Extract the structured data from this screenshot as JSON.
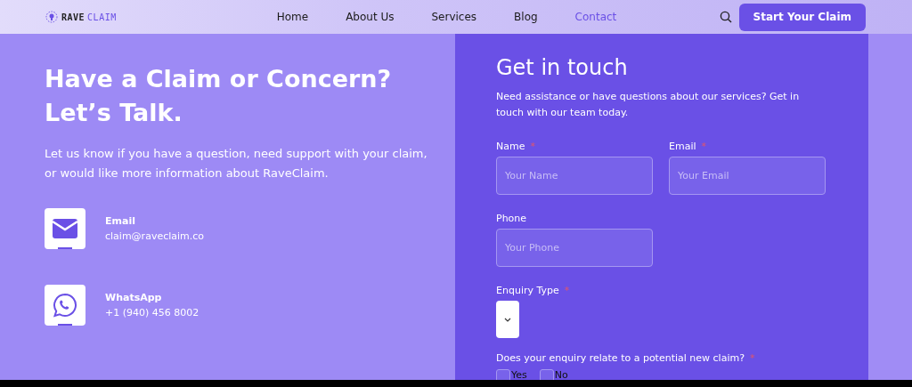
{
  "header": {
    "logo": {
      "part_1": "RAVE",
      "part_2": "CLAIM"
    },
    "nav": [
      {
        "label": "Home",
        "selected": false
      },
      {
        "label": "About Us",
        "selected": false
      },
      {
        "label": "Services",
        "selected": false
      },
      {
        "label": "Blog",
        "selected": false
      },
      {
        "label": "Contact",
        "selected": true
      }
    ],
    "cta": "Start Your Claim"
  },
  "intro": {
    "title_lines": [
      "Have a Claim or Concern?",
      "Let’s Talk."
    ],
    "text": "Let us know if you have a question, need support with your claim, or would like more information about RaveClaim.",
    "contacts": [
      {
        "kind": "email",
        "label": "Email",
        "value": "claim@raveclaim.co"
      },
      {
        "kind": "whatsapp",
        "label": "WhatsApp",
        "value": "+1 (940) 456 8002"
      }
    ]
  },
  "form": {
    "title": "Get in touch",
    "subtitle": "Need assistance or have questions about our services? Get in touch with our team today.",
    "fields": [
      {
        "label": "Name",
        "required_mark": "*",
        "placeholder": "Your Name"
      },
      {
        "label": "Email",
        "required_mark": "*",
        "placeholder": "Your Email"
      },
      {
        "label": "Phone",
        "placeholder": "Your Phone"
      }
    ],
    "enquiry": {
      "label": "Enquiry Type",
      "required_mark": "*"
    },
    "question": {
      "label": "Does your enquiry relate to a potential new claim?",
      "required_mark": "*",
      "options": [
        {
          "label": "Yes",
          "checked": false
        },
        {
          "label": "No",
          "checked": false
        }
      ]
    }
  }
}
